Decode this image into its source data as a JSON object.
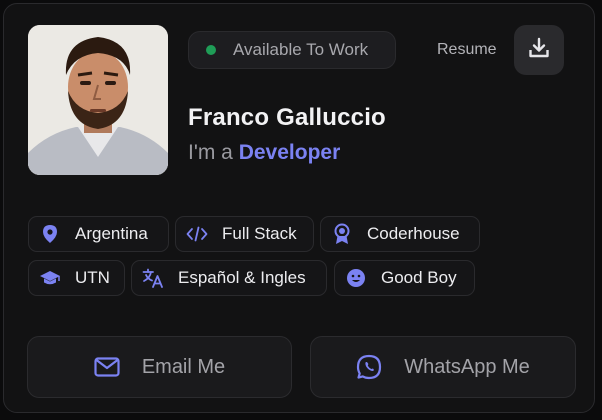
{
  "status": {
    "label": "Available To Work",
    "dot_color": "#1f9d57"
  },
  "resume": {
    "label": "Resume",
    "icon": "download-icon"
  },
  "profile": {
    "name": "Franco Galluccio",
    "role_prefix": "I'm a",
    "role": "Developer",
    "avatar_icon": "avatar"
  },
  "tags": [
    {
      "label": "Argentina",
      "icon": "location-pin-icon"
    },
    {
      "label": "Full Stack",
      "icon": "code-icon"
    },
    {
      "label": "Coderhouse",
      "icon": "award-icon"
    },
    {
      "label": "UTN",
      "icon": "graduation-cap-icon"
    },
    {
      "label": "Español & Ingles",
      "icon": "translate-icon"
    },
    {
      "label": "Good Boy",
      "icon": "smile-icon"
    }
  ],
  "actions": {
    "email": {
      "label": "Email Me",
      "icon": "mail-icon"
    },
    "whatsapp": {
      "label": "WhatsApp Me",
      "icon": "whatsapp-icon"
    }
  },
  "colors": {
    "accent": "#7b82f2",
    "background": "#121213",
    "text": "#f2f2f4",
    "muted": "#9a9aa0"
  }
}
